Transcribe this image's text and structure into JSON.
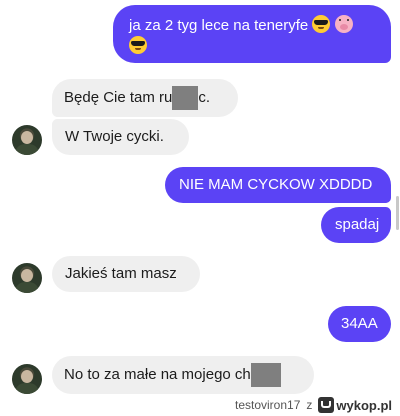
{
  "messages": [
    {
      "side": "sent",
      "text": "ja za 2 tyg lece na teneryfe",
      "emoji": [
        "sunglasses-emoji",
        "pig-emoji",
        "sunglasses-emoji"
      ]
    },
    {
      "side": "recv",
      "text_before": "Będę Cie tam ru",
      "text_after": "c.",
      "censored": true
    },
    {
      "side": "recv",
      "text": "W Twoje cycki."
    },
    {
      "side": "sent",
      "text": "NIE MAM CYCKOW XDDDD"
    },
    {
      "side": "sent",
      "text": "spadaj"
    },
    {
      "side": "recv",
      "text": "Jakieś tam masz"
    },
    {
      "side": "sent",
      "text": "34AA"
    },
    {
      "side": "recv",
      "text_before": "No to za małe na mojego ch",
      "censored": true
    }
  ],
  "footer": {
    "user": "testoviron17",
    "separator": "z",
    "site": "wykop.pl"
  },
  "colors": {
    "sent_bubble": "#5b43f5",
    "received_bubble": "#efefef"
  }
}
